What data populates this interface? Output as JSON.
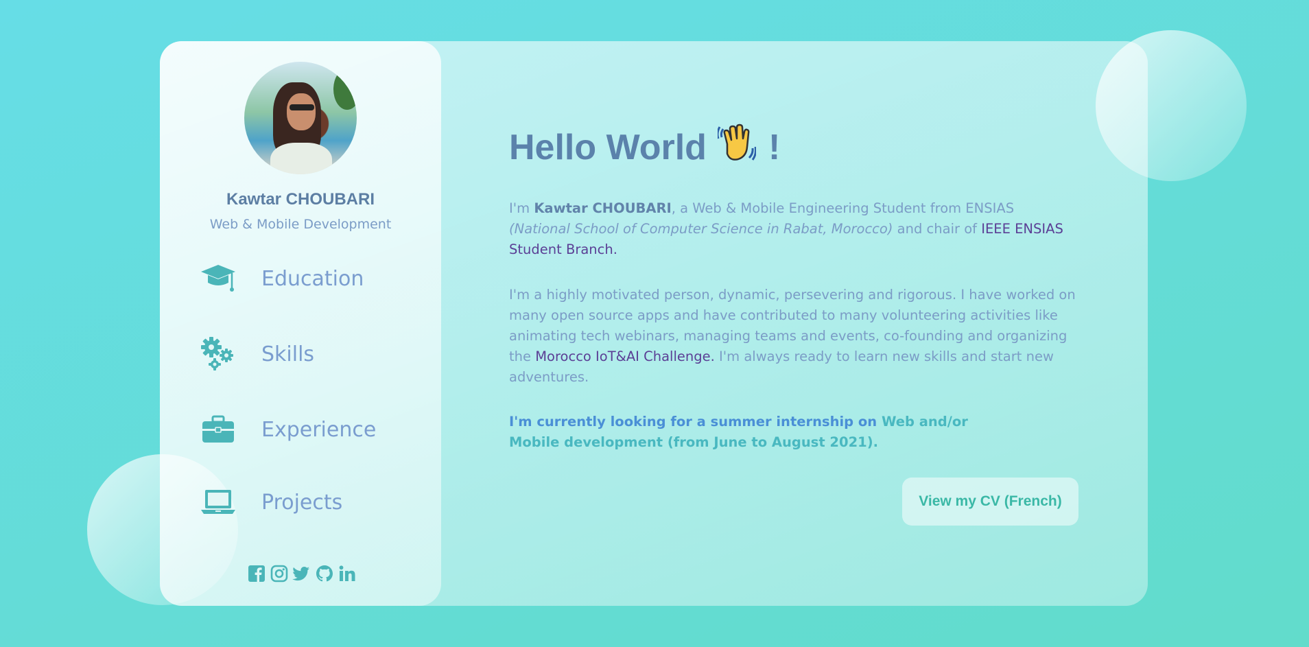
{
  "profile": {
    "name": "Kawtar CHOUBARI",
    "subtitle": "Web & Mobile Development"
  },
  "nav": {
    "education": "Education",
    "skills": "Skills",
    "experience": "Experience",
    "projects": "Projects"
  },
  "icons": {
    "education": "graduation-cap-icon",
    "skills": "gears-icon",
    "experience": "briefcase-icon",
    "projects": "laptop-icon"
  },
  "socials": [
    "facebook",
    "instagram",
    "twitter",
    "github",
    "linkedin"
  ],
  "main": {
    "greeting": "Hello World",
    "wave_emoji": "👋",
    "exclamation": "!",
    "intro": {
      "im": "I'm ",
      "name": "Kawtar CHOUBARI",
      "role": ", a Web & Mobile Engineering Student from ENSIAS ",
      "school": "(National School of Computer Science in Rabat, Morocco)",
      "chair": " and chair of ",
      "ieee_link": "IEEE ENSIAS Student Branch."
    },
    "about": {
      "before": "I'm a highly motivated person, dynamic, persevering and rigorous. I have worked on many open source apps and have contributed to many volunteering activities like animating tech webinars, managing teams and events, co-founding and organizing the ",
      "challenge_link": "Morocco IoT&AI Challenge.",
      "after": " I'm always ready to learn new skills and start new adventures."
    },
    "looking": {
      "part1": "I'm currently looking for a summer internship on ",
      "part2": "Web and/or Mobile development (from June to August 2021)."
    },
    "cv_button": "View my CV (French)"
  },
  "colors": {
    "accent": "#4ab5b8",
    "title": "#5b82ab",
    "text": "#7b9cc6",
    "link": "#5b3f95",
    "button_text": "#3ab8a6"
  }
}
